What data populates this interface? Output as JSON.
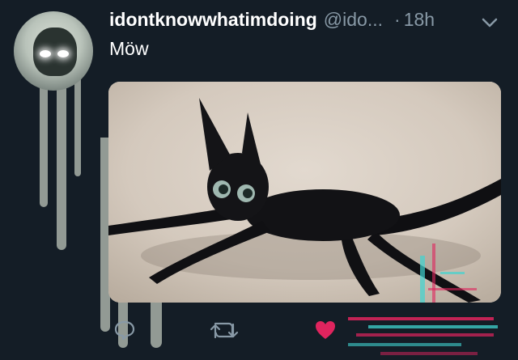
{
  "tweet": {
    "display_name": "idontknowwhatimdoing",
    "handle": "@ido...",
    "separator": "·",
    "time": "18h",
    "text": "Möw"
  },
  "icons": {
    "avatar": "avatar",
    "menu": "chevron-down-icon",
    "reply": "reply-icon",
    "retweet": "retweet-icon",
    "like": "heart-icon"
  },
  "colors": {
    "background": "#141d26",
    "text_primary": "#ffffff",
    "text_secondary": "#8899a6",
    "like": "#e0245e"
  }
}
